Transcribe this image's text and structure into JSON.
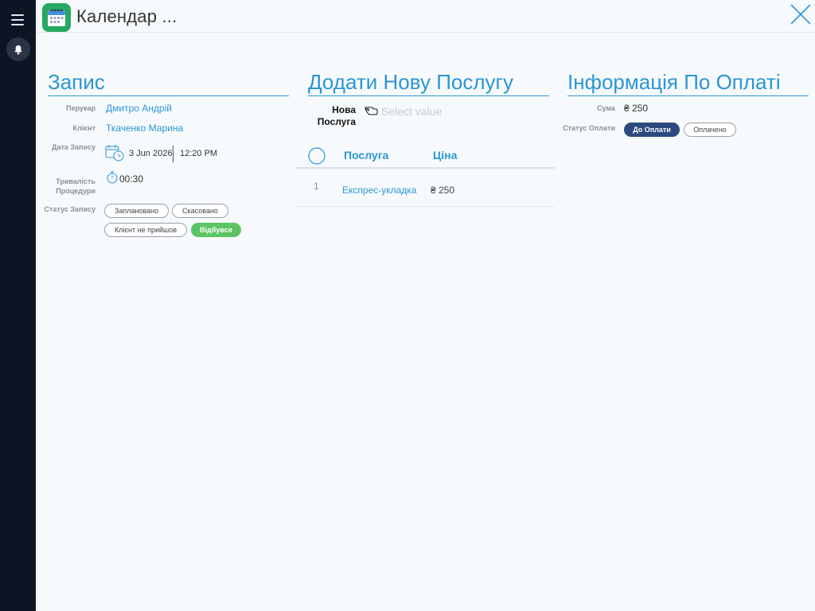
{
  "window": {
    "title": "Календар ..."
  },
  "record": {
    "title": "Запис",
    "hairdresser_label": "Перукар",
    "hairdresser": "Дмитро Андрій",
    "client_label": "Клієнт",
    "client": "Ткаченко Марина",
    "date_label": "Дата Запису",
    "date": "3 Jun 2026",
    "time": "12:20 PM",
    "duration_label": "Тривалість Процедури",
    "duration": "00:30",
    "status_label": "Статус Запису",
    "status_options": [
      "Заплановано",
      "Скасовано",
      "Клієнт не прийшов",
      "Відбувся"
    ],
    "status_selected": "Відбувся"
  },
  "add_service": {
    "title": "Додати Нову Послугу",
    "new_service_label": "Нова Послуга",
    "select_placeholder": "Select value",
    "columns": [
      "Послуга",
      "Ціна"
    ],
    "rows": [
      {
        "index": "1",
        "service": "Експрес-укладка",
        "price": "₴ 250"
      }
    ]
  },
  "payment": {
    "title": "Інформація По Оплаті",
    "sum_label": "Сума",
    "sum": "₴ 250",
    "status_label": "Статус Оплати",
    "status_options": [
      "До Оплати",
      "Оплачено"
    ],
    "status_selected": "До Оплати"
  },
  "colors": {
    "accent": "#2b95d6",
    "sidebar": "#0c1524",
    "success": "#5dc463",
    "navy": "#2c4a7e"
  }
}
